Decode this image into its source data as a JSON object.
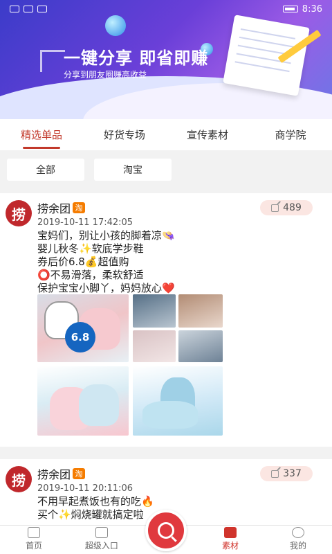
{
  "status_bar": {
    "time": "8:36"
  },
  "banner": {
    "title": "一键分享 即省即赚",
    "subtitle": "分享到朋友圈赚高收益"
  },
  "tabs": [
    {
      "label": "精选单品",
      "active": true
    },
    {
      "label": "好货专场",
      "active": false
    },
    {
      "label": "宣传素材",
      "active": false
    },
    {
      "label": "商学院",
      "active": false
    }
  ],
  "filters": [
    {
      "label": "全部"
    },
    {
      "label": "淘宝"
    }
  ],
  "posts": [
    {
      "avatar_text": "捞",
      "name": "捞余团",
      "badge": "淘",
      "time": "2019-10-11 17:42:05",
      "share_count": "489",
      "lines": [
        "宝妈们，别让小孩的脚着凉👒",
        "婴儿秋冬✨软底学步鞋",
        "券后价6.8💰超值购",
        "⭕不易滑落，柔软舒适",
        "保护宝宝小脚丫，妈妈放心❤️"
      ],
      "price_tag": "6.8"
    },
    {
      "avatar_text": "捞",
      "name": "捞余团",
      "badge": "淘",
      "time": "2019-10-11 20:11:06",
      "share_count": "337",
      "lines": [
        "不用早起煮饭也有的吃🔥",
        "买个✨焖烧罐就搞定啦"
      ]
    }
  ],
  "bottom_nav": [
    {
      "label": "首页",
      "icon": "home-icon",
      "active": false
    },
    {
      "label": "超级入口",
      "icon": "entry-icon",
      "active": false
    },
    {
      "label": "素材",
      "icon": "folder-icon",
      "active": true
    },
    {
      "label": "我的",
      "icon": "user-icon",
      "active": false
    }
  ],
  "colors": {
    "accent": "#c2392b",
    "search_button": "#e0393e",
    "badge": "#f57c00"
  }
}
